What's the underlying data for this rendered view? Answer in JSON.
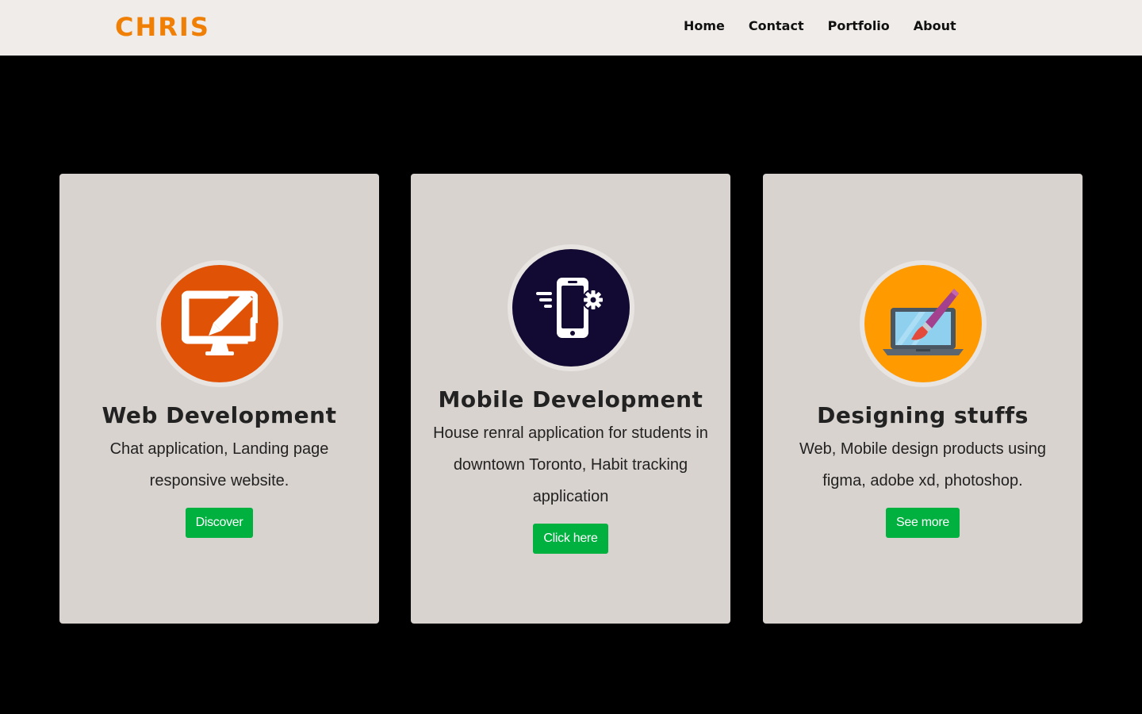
{
  "nav": {
    "brand": "CHRIS",
    "links": [
      "Home",
      "Contact",
      "Portfolio",
      "About"
    ]
  },
  "cards": [
    {
      "title": "Web Development",
      "description": "Chat application, Landing page responsive website.",
      "button": "Discover",
      "icon": "monitor-pencil-icon",
      "icon_color": "#e05206"
    },
    {
      "title": "Mobile Development",
      "description": "House renral application for students in downtown Toronto, Habit tracking application",
      "button": "Click here",
      "icon": "smartphone-gear-icon",
      "icon_color": "#120a33"
    },
    {
      "title": "Designing stuffs",
      "description": "Web, Mobile design products using figma, adobe xd, photoshop.",
      "button": "See more",
      "icon": "laptop-paintbrush-icon",
      "icon_color": "#ff9b00"
    }
  ],
  "colors": {
    "brand": "#f07f06",
    "navbar_bg": "#f0ece9",
    "page_bg": "#000000",
    "card_bg": "#d9d3cf",
    "button_bg": "#00b140"
  }
}
